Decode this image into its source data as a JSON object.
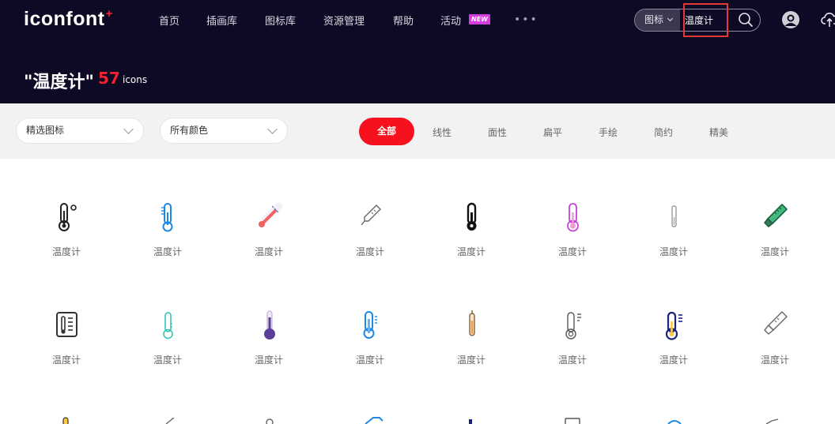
{
  "header": {
    "logo_text": "iconfont",
    "logo_mark": "+",
    "nav": [
      {
        "label": "首页"
      },
      {
        "label": "插画库"
      },
      {
        "label": "图标库"
      },
      {
        "label": "资源管理"
      },
      {
        "label": "帮助"
      },
      {
        "label": "活动"
      }
    ],
    "new_badge": "NEW",
    "more": "•••",
    "search": {
      "type_label": "图标",
      "value": "温度计"
    }
  },
  "result": {
    "title": "\"温度计\"",
    "count": "57",
    "unit": "icons"
  },
  "filters": {
    "dropdowns": [
      {
        "label": "精选图标"
      },
      {
        "label": "所有颜色"
      }
    ],
    "tabs": [
      {
        "label": "全部",
        "active": true
      },
      {
        "label": "线性"
      },
      {
        "label": "面性"
      },
      {
        "label": "扁平"
      },
      {
        "label": "手绘"
      },
      {
        "label": "简约"
      },
      {
        "label": "精美"
      }
    ]
  },
  "icons": [
    {
      "label": "温度计",
      "icon": "thermometer-celsius-icon"
    },
    {
      "label": "温度计",
      "icon": "thermometer-blue-icon"
    },
    {
      "label": "温度计",
      "icon": "thermometer-red-tilted-icon"
    },
    {
      "label": "温度计",
      "icon": "thermometer-outline-tilted-icon"
    },
    {
      "label": "温度计",
      "icon": "thermometer-black-icon"
    },
    {
      "label": "温度计",
      "icon": "thermometer-purple-icon"
    },
    {
      "label": "温度计",
      "icon": "thermometer-thin-icon"
    },
    {
      "label": "温度计",
      "icon": "thermometer-green-tilted-icon"
    },
    {
      "label": "温度计",
      "icon": "thermometer-panel-icon"
    },
    {
      "label": "温度计",
      "icon": "thermometer-teal-icon"
    },
    {
      "label": "温度计",
      "icon": "thermometer-violet-bulb-icon"
    },
    {
      "label": "温度计",
      "icon": "thermometer-blue-scale-icon"
    },
    {
      "label": "温度计",
      "icon": "thermometer-orange-icon"
    },
    {
      "label": "温度计",
      "icon": "thermometer-lines-icon"
    },
    {
      "label": "温度计",
      "icon": "thermometer-navy-yellow-icon"
    },
    {
      "label": "温度计",
      "icon": "thermometer-gray-tilted-icon"
    }
  ],
  "colors": {
    "header_bg": "#0c0a24",
    "accent": "#f5111e",
    "filter_bg": "#f2f2f2"
  }
}
